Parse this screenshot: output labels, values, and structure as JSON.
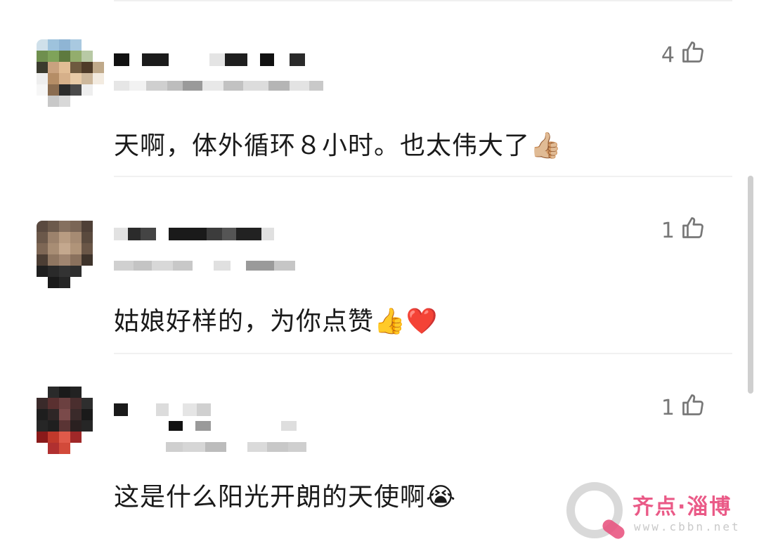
{
  "comments": [
    {
      "text": "天啊，体外循环８小时。也太伟大了",
      "emoji": "👍🏼",
      "likes": "4"
    },
    {
      "text": "姑娘好样的，为你点赞",
      "emoji": "👍❤️",
      "likes": "1"
    },
    {
      "text": "这是什么阳光开朗的天使啊",
      "emoji": "😭",
      "likes": "1"
    }
  ],
  "watermark": {
    "title": "齐点·淄博",
    "url": "www.cbbn.net"
  },
  "icons": {
    "like": "thumbs-up-outline-icon"
  },
  "colors": {
    "text": "#1a1a1a",
    "muted": "#777777",
    "watermark_pink": "#ea5a87"
  }
}
